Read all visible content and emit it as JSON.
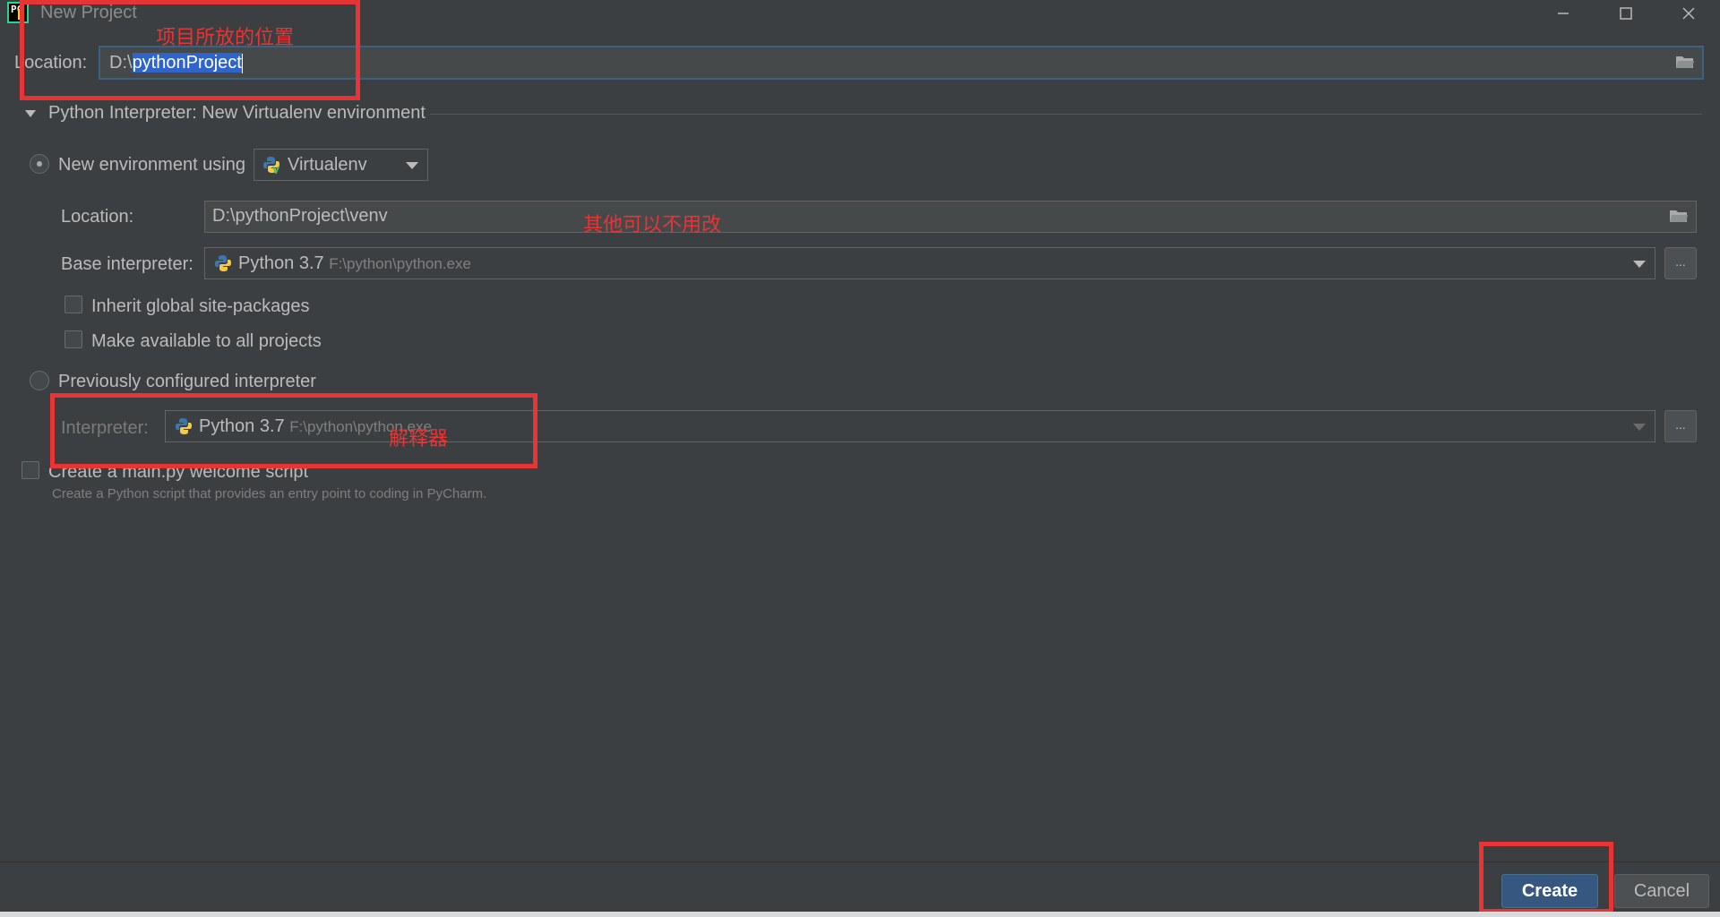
{
  "window": {
    "title": "New Project",
    "minimize_glyph": "—",
    "maximize_glyph": "☐",
    "close_glyph": "✕"
  },
  "location": {
    "label": "Location:",
    "prefix": "D:\\",
    "selected": "pythonProject"
  },
  "section": {
    "title": "Python Interpreter: New Virtualenv environment"
  },
  "new_env": {
    "label": "New environment using",
    "tool": "Virtualenv",
    "location_label": "Location:",
    "location_value": "D:\\pythonProject\\venv",
    "base_label": "Base interpreter:",
    "base_name": "Python 3.7",
    "base_path": "F:\\python\\python.exe",
    "inherit_label": "Inherit global site-packages",
    "available_label": "Make available to all projects"
  },
  "prev": {
    "label": "Previously configured interpreter",
    "interp_label": "Interpreter:",
    "interp_name": "Python 3.7",
    "interp_path": "F:\\python\\python.exe"
  },
  "welcome": {
    "label": "Create a main.py welcome script",
    "description": "Create a Python script that provides an entry point to coding in PyCharm."
  },
  "dots_label": "...",
  "annotations": {
    "location_note": "项目所放的位置",
    "others_note": "其他可以不用改",
    "interp_note": "解释器"
  },
  "buttons": {
    "create": "Create",
    "cancel": "Cancel"
  },
  "colors": {
    "background": "#3c3f41",
    "accent": "#365880",
    "annotation": "#e83434",
    "selection": "#2f65ca"
  }
}
